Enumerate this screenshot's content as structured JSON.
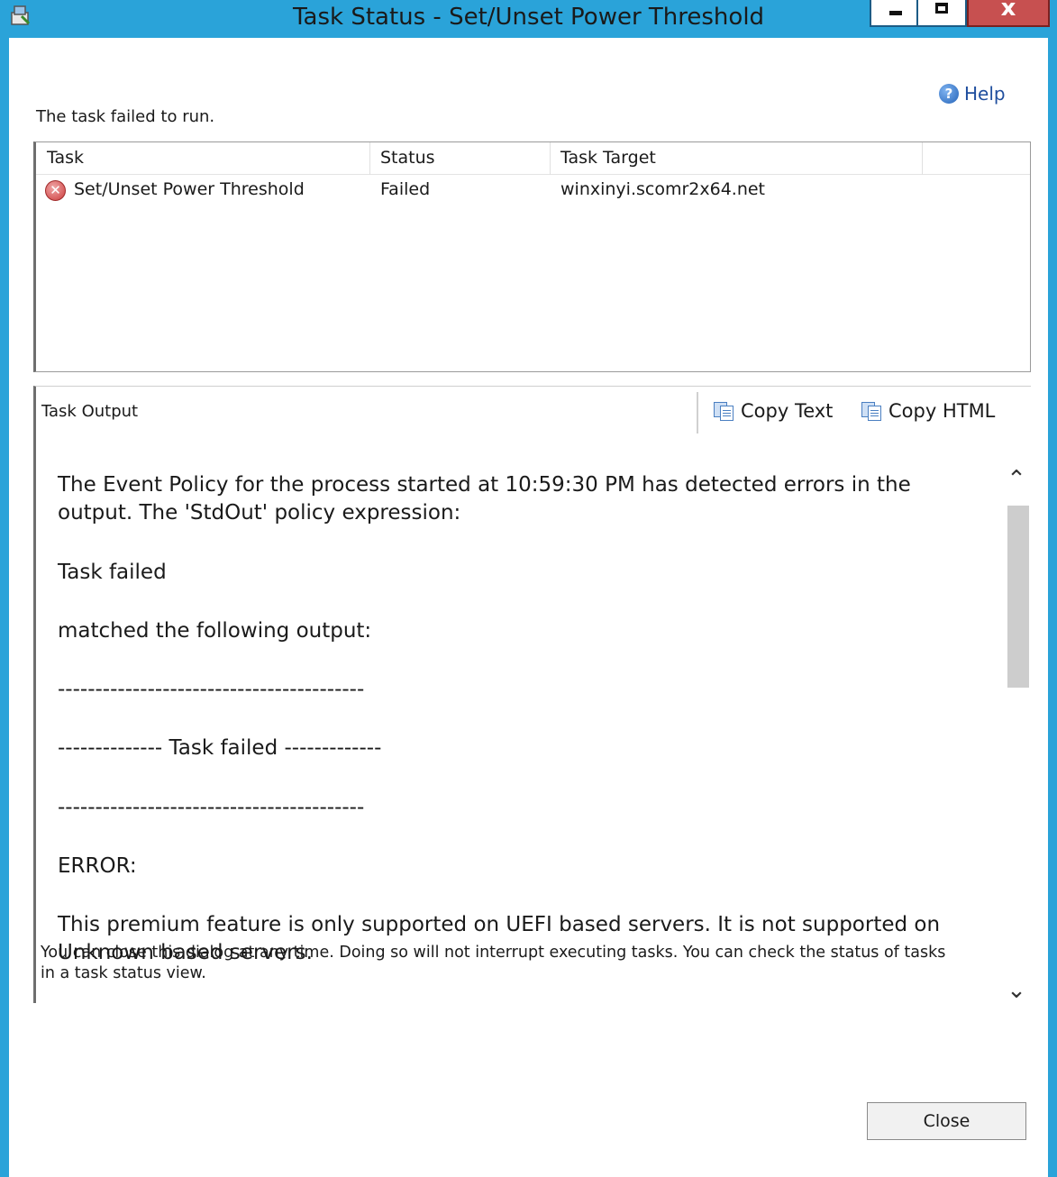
{
  "window": {
    "title": "Task Status - Set/Unset Power Threshold",
    "close_glyph": "x"
  },
  "help": {
    "label": "Help"
  },
  "status_message": "The task failed to run.",
  "task_list": {
    "columns": [
      "Task",
      "Status",
      "Task Target"
    ],
    "rows": [
      {
        "task": "Set/Unset Power Threshold",
        "status": "Failed",
        "target": "winxinyi.scomr2x64.net"
      }
    ]
  },
  "output": {
    "title": "Task Output",
    "copy_text_label": "Copy Text",
    "copy_html_label": "Copy HTML",
    "lines": [
      "The Event Policy for the process started at 10:59:30 PM has detected errors in the output. The 'StdOut' policy expression:",
      "Task failed",
      "matched the following output:",
      "-----------------------------------------",
      "-------------- Task failed -------------",
      "-----------------------------------------",
      "ERROR:",
      "This premium feature is only supported on UEFI based servers. It is not supported on Unknown based servers."
    ]
  },
  "footnote": "You can close this dialog at any time. Doing so will not interrupt executing tasks. You can check the status of tasks in a task status view.",
  "close_button": {
    "label": "Close"
  },
  "colors": {
    "title_bar": "#2aa3d9",
    "close_control": "#c75050",
    "error_icon": "#cc3b3b",
    "help_link": "#1f4e9e"
  }
}
